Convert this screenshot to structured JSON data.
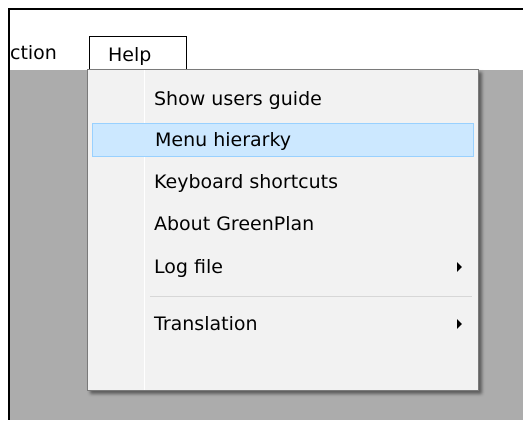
{
  "menubar": {
    "items": [
      {
        "label": "ction"
      },
      {
        "label": "Help"
      }
    ]
  },
  "help_menu": {
    "items": [
      {
        "label": "Show users guide"
      },
      {
        "label": "Menu hierarky"
      },
      {
        "label": "Keyboard shortcuts"
      },
      {
        "label": "About GreenPlan"
      },
      {
        "label": "Log file"
      },
      {
        "label": "Translation"
      }
    ]
  }
}
